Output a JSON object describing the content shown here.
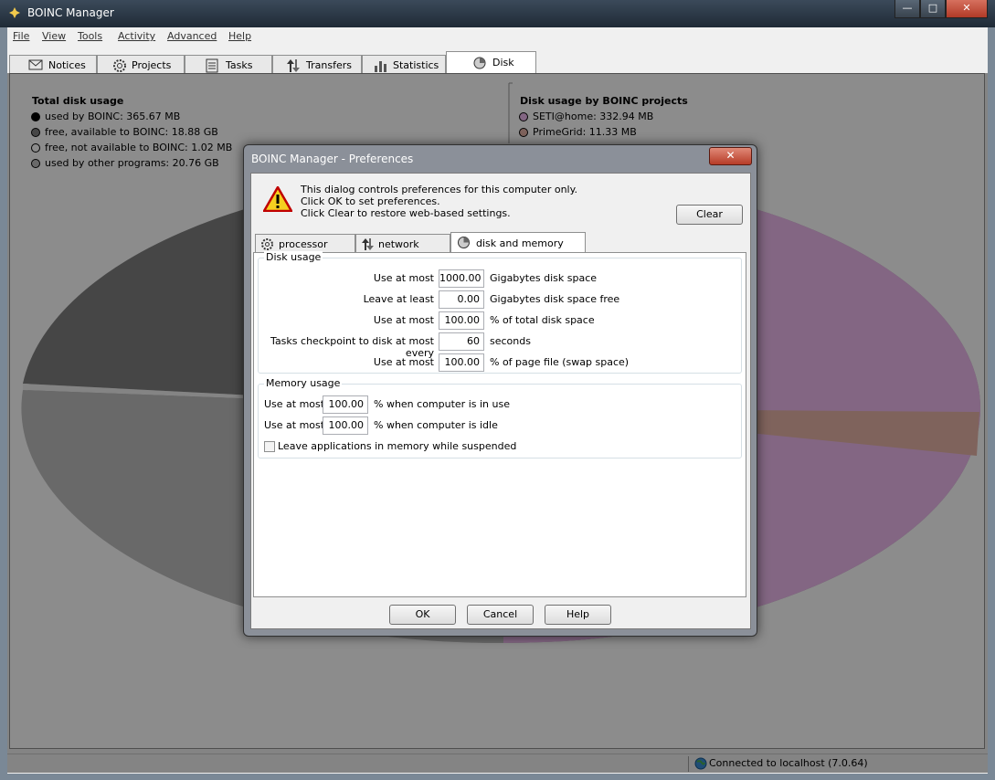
{
  "window": {
    "title": "BOINC Manager",
    "min": "—",
    "max": "□",
    "close": "✕"
  },
  "menu": [
    "File",
    "View",
    "Tools",
    "Activity",
    "Advanced",
    "Help"
  ],
  "tabs": [
    "Notices",
    "Projects",
    "Tasks",
    "Transfers",
    "Statistics",
    "Disk"
  ],
  "disk": {
    "left_title": "Total disk usage",
    "left_items": [
      {
        "label": "used by BOINC: 365.67 MB",
        "color": "#000000"
      },
      {
        "label": "free, available to BOINC: 18.88 GB",
        "color": "#808080"
      },
      {
        "label": "free, not available to BOINC: 1.02 MB",
        "color": "#ffffff"
      },
      {
        "label": "used by other programs: 20.76 GB",
        "color": "#c0c0c0"
      }
    ],
    "right_title": "Disk usage by BOINC projects",
    "right_items": [
      {
        "label": "SETI@home: 332.94 MB",
        "color": "#efbbef"
      },
      {
        "label": "PrimeGrid: 11.33 MB",
        "color": "#e8b4a8"
      }
    ]
  },
  "status": {
    "text": "Connected to localhost (7.0.64)"
  },
  "dialog": {
    "title": "BOINC Manager - Preferences",
    "close": "✕",
    "info_lines": [
      "This dialog controls preferences for this computer only.",
      "Click OK to set preferences.",
      "Click Clear to restore web-based settings."
    ],
    "clear": "Clear",
    "tabs": [
      "processor usage",
      "network usage",
      "disk and memory usage"
    ],
    "disk_group": {
      "title": "Disk usage",
      "rows": [
        {
          "label": "Use at most",
          "value": "1000.00",
          "unit": "Gigabytes disk space"
        },
        {
          "label": "Leave at least",
          "value": "0.00",
          "unit": "Gigabytes disk space free"
        },
        {
          "label": "Use at most",
          "value": "100.00",
          "unit": "% of total disk space"
        },
        {
          "label": "Tasks checkpoint to disk at most every",
          "value": "60",
          "unit": "seconds"
        },
        {
          "label": "Use at most",
          "value": "100.00",
          "unit": "% of page file (swap space)"
        }
      ]
    },
    "memory_group": {
      "title": "Memory usage",
      "rows": [
        {
          "label": "Use at most",
          "value": "100.00",
          "unit": "% when computer is in use"
        },
        {
          "label": "Use at most",
          "value": "100.00",
          "unit": "% when computer is idle"
        }
      ],
      "checkbox": "Leave applications in memory while suspended",
      "checked": false
    },
    "buttons": [
      "OK",
      "Cancel",
      "Help"
    ]
  }
}
